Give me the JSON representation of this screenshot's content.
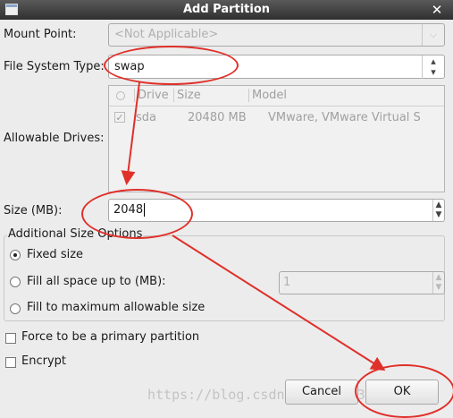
{
  "window": {
    "title": "Add Partition"
  },
  "mount_point": {
    "label": "Mount Point:",
    "value": "<Not Applicable>"
  },
  "fs_type": {
    "label": "File System Type:",
    "value": "swap"
  },
  "drives": {
    "label": "Allowable Drives:",
    "columns": [
      "Drive",
      "Size",
      "Model"
    ],
    "rows": [
      {
        "drive": "sda",
        "size": "20480 MB",
        "model": "VMware, VMware Virtual S"
      }
    ]
  },
  "size": {
    "label": "Size (MB):",
    "value": "2048"
  },
  "size_options": {
    "title": "Additional Size Options",
    "fixed": "Fixed size",
    "fill_up_to": "Fill all space up to (MB):",
    "fill_up_to_value": "1",
    "fill_max": "Fill to maximum allowable size"
  },
  "primary": {
    "label": "Force to be a primary partition"
  },
  "encrypt": {
    "label": "Encrypt"
  },
  "buttons": {
    "cancel": "Cancel",
    "ok": "OK"
  },
  "watermark": "https://blog.csdn.net/x1803749491",
  "annotation_color": "#e0302a"
}
